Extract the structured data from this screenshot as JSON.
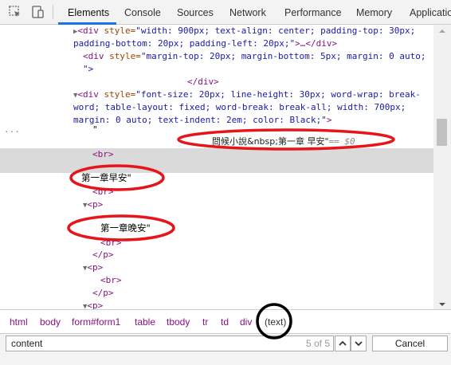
{
  "tabs": [
    "Elements",
    "Console",
    "Sources",
    "Network",
    "Performance",
    "Memory",
    "Application"
  ],
  "code": {
    "line1": {
      "tag_open": "<div",
      "attr": " style=",
      "val": "\"width: 900px; text-align: center; padding-top: 30px;",
      "tail_tag": ""
    },
    "line2": {
      "val": "padding-bottom: 20px; padding-left: 20px;\"",
      "ellipsis": ">…</div>"
    },
    "line3": {
      "tag_open": "<div",
      "attr": " style=",
      "val": "\"margin-top: 20px; margin-bottom: 5px; margin: 0 auto;"
    },
    "line4": {
      "val": "\">"
    },
    "line5": {
      "tag": "</div>"
    },
    "line6": {
      "tag_open": "<div",
      "attr": " style=",
      "val": "\"font-size: 20px; line-height: 30px; word-wrap: break-"
    },
    "line7": {
      "val": "word; table-layout: fixed; word-break: break-all; width: 700px;"
    },
    "line8": {
      "val": "margin: 0 auto; text-indent: 2em; color: Black;\"",
      "close": ">"
    },
    "dots": "...",
    "sel_quote": "\"",
    "sel_text": "問候小說&nbsp;第一章 早安\"",
    "sel_eq": "== $0",
    "br1": "<br>",
    "text1": "第一章早安\"",
    "br2": "<br>",
    "p1": "<p>",
    "text2": "第一章晚安\"",
    "br3": "<br>",
    "p1_close": "</p>",
    "p2": "<p>",
    "br4": "<br>",
    "p2_close": "</p>",
    "p3": "<p>"
  },
  "breadcrumbs": [
    "html",
    "body",
    "form#form1",
    "table",
    "tbody",
    "tr",
    "td",
    "div",
    "(text)"
  ],
  "search": {
    "value": "content",
    "match_count": "5 of 5",
    "cancel_label": "Cancel"
  },
  "colors": {
    "accent": "#1a73e8",
    "annotation": "#e8141c"
  }
}
